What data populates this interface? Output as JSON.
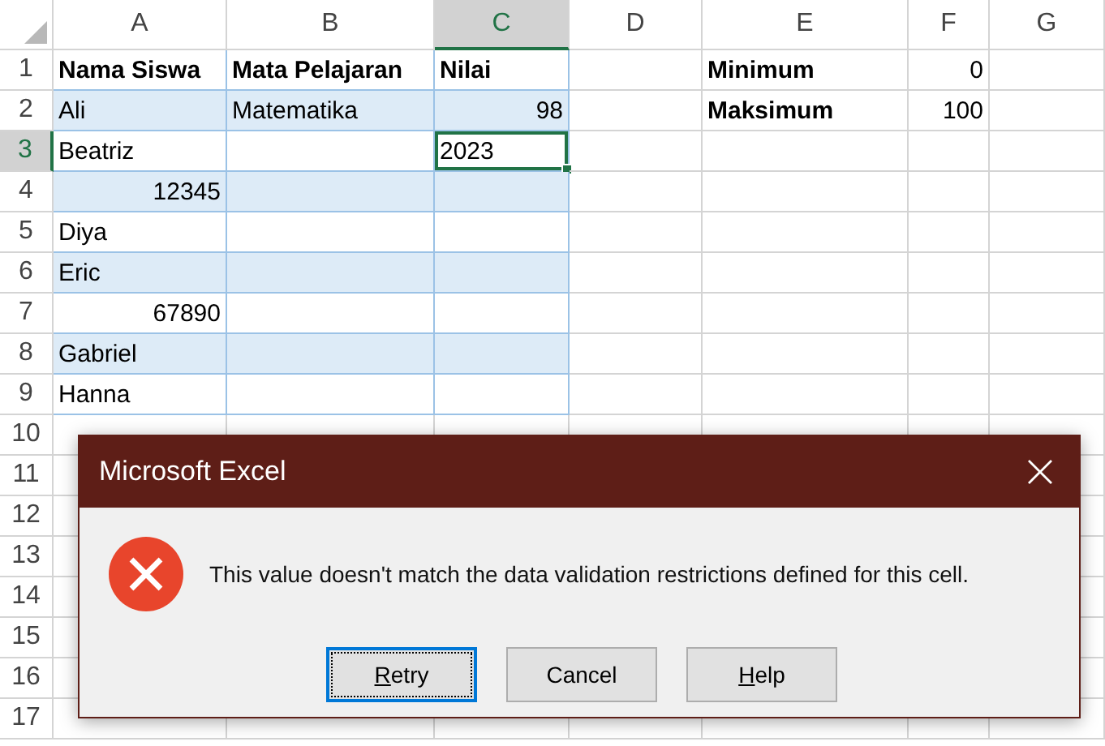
{
  "sheet": {
    "columns": [
      {
        "label": "A",
        "selected": false
      },
      {
        "label": "B",
        "selected": false
      },
      {
        "label": "C",
        "selected": true
      },
      {
        "label": "D",
        "selected": false
      },
      {
        "label": "E",
        "selected": false
      },
      {
        "label": "F",
        "selected": false
      },
      {
        "label": "G",
        "selected": false
      }
    ],
    "rows": [
      {
        "label": "1",
        "selected": false
      },
      {
        "label": "2",
        "selected": false
      },
      {
        "label": "3",
        "selected": true
      },
      {
        "label": "4",
        "selected": false
      },
      {
        "label": "5",
        "selected": false
      },
      {
        "label": "6",
        "selected": false
      },
      {
        "label": "7",
        "selected": false
      },
      {
        "label": "8",
        "selected": false
      },
      {
        "label": "9",
        "selected": false
      },
      {
        "label": "10",
        "selected": false
      },
      {
        "label": "11",
        "selected": false
      },
      {
        "label": "12",
        "selected": false
      },
      {
        "label": "13",
        "selected": false
      },
      {
        "label": "14",
        "selected": false
      },
      {
        "label": "15",
        "selected": false
      },
      {
        "label": "16",
        "selected": false
      },
      {
        "label": "17",
        "selected": false
      }
    ],
    "table": {
      "header": [
        "Nama Siswa",
        "Mata Pelajaran",
        "Nilai"
      ],
      "rows": [
        [
          {
            "text": "Ali",
            "kind": "text"
          },
          {
            "text": "Matematika",
            "kind": "text"
          },
          {
            "text": "98",
            "kind": "number"
          }
        ],
        [
          {
            "text": "Beatriz",
            "kind": "text"
          },
          null,
          {
            "text": "2023",
            "kind": "text"
          }
        ],
        [
          {
            "text": "12345",
            "kind": "number"
          },
          null,
          null
        ],
        [
          {
            "text": "Diya",
            "kind": "text"
          },
          null,
          null
        ],
        [
          {
            "text": "Eric",
            "kind": "text"
          },
          null,
          null
        ],
        [
          {
            "text": "67890",
            "kind": "number"
          },
          null,
          null
        ],
        [
          {
            "text": "Gabriel",
            "kind": "text"
          },
          null,
          null
        ],
        [
          {
            "text": "Hanna",
            "kind": "text"
          },
          null,
          null
        ]
      ]
    },
    "side": [
      {
        "label": "Minimum",
        "value": "0"
      },
      {
        "label": "Maksimum",
        "value": "100"
      }
    ]
  },
  "dialog": {
    "title": "Microsoft Excel",
    "message": "This value doesn't match the data validation restrictions defined for this cell.",
    "buttons": [
      {
        "label": "Retry",
        "underline_first": true,
        "focused": true
      },
      {
        "label": "Cancel",
        "underline_first": false,
        "focused": false
      },
      {
        "label": "Help",
        "underline_first": true,
        "focused": false
      }
    ]
  }
}
